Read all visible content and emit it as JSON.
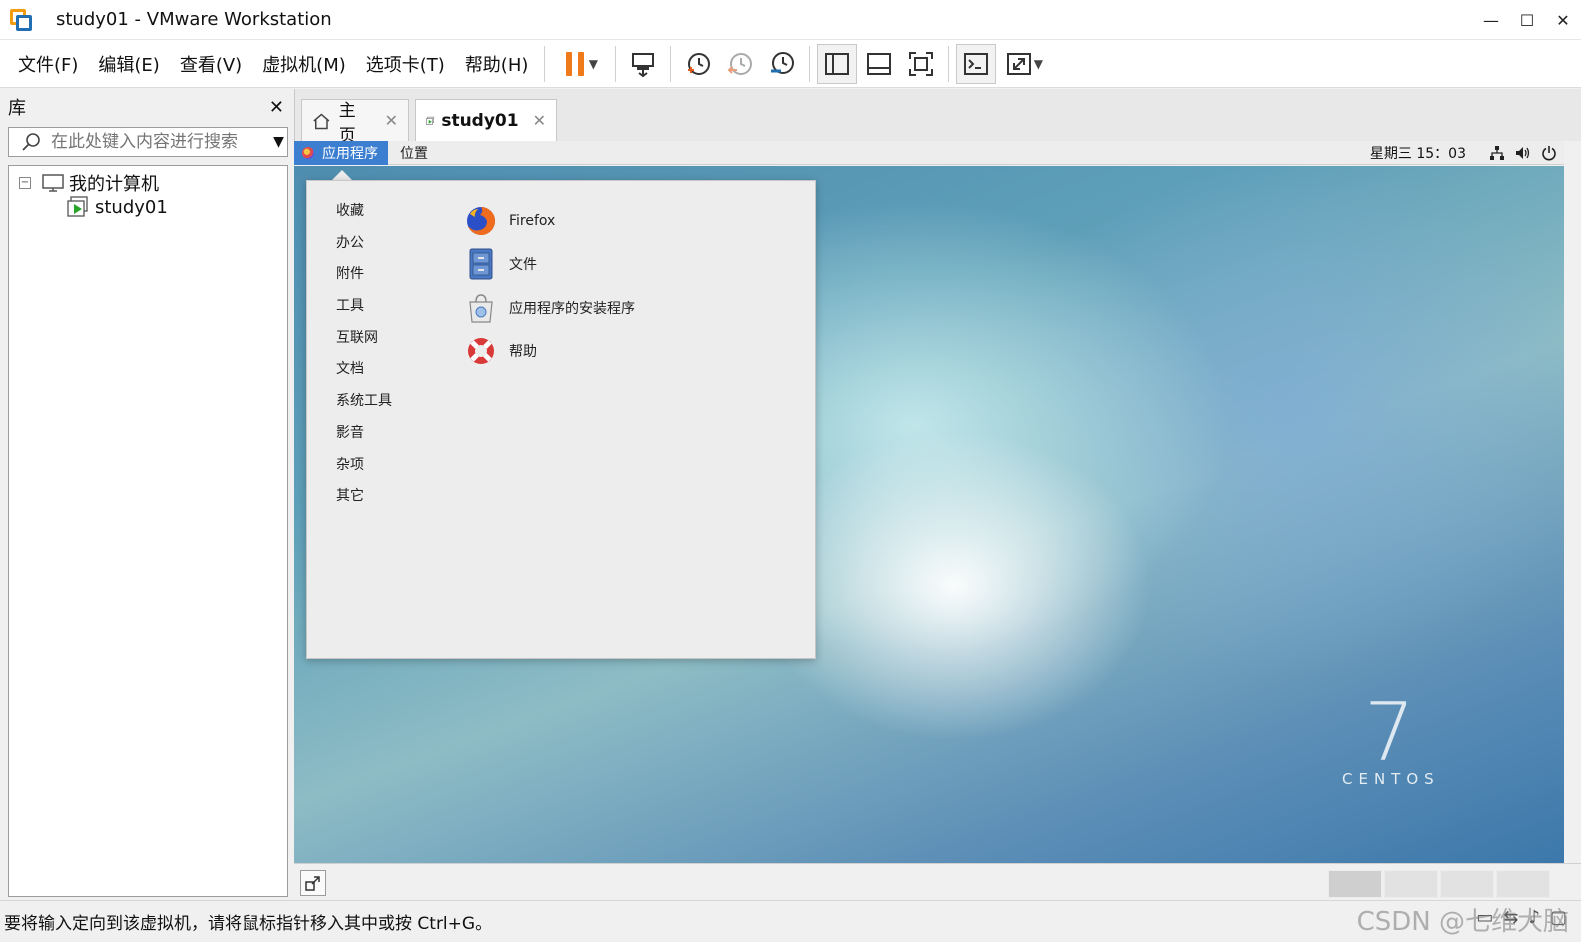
{
  "window": {
    "title": "study01 - VMware Workstation",
    "controls": {
      "minimize": "—",
      "maximize": "☐",
      "close": "✕"
    }
  },
  "menu": {
    "items": [
      "文件(F)",
      "编辑(E)",
      "查看(V)",
      "虚拟机(M)",
      "选项卡(T)",
      "帮助(H)"
    ]
  },
  "toolbar": {
    "buttons": [
      "pause-icon",
      "send-ctrl-alt-del-icon",
      "snapshot-take-icon",
      "snapshot-revert-icon",
      "snapshot-manager-icon",
      "library-view-icon",
      "thumbnail-view-icon",
      "full-screen-icon",
      "console-view-icon",
      "stretch-icon"
    ],
    "accent": "#f07a1a"
  },
  "library": {
    "title": "库",
    "close": "✕",
    "search_placeholder": "在此处键入内容进行搜索",
    "tree": {
      "root": "我的计算机",
      "toggle": "−",
      "children": [
        "study01"
      ]
    }
  },
  "tabs": [
    {
      "label": "主页",
      "icon": "home-icon",
      "close": "✕",
      "active": false
    },
    {
      "label": "study01",
      "icon": "vm-running-icon",
      "close": "✕",
      "active": true
    }
  ],
  "guest": {
    "top_bar": {
      "applications": "应用程序",
      "places": "位置",
      "clock": "星期三 15：03"
    },
    "app_menu": {
      "categories": [
        "收藏",
        "办公",
        "附件",
        "工具",
        "互联网",
        "文档",
        "系统工具",
        "影音",
        "杂项",
        "其它"
      ],
      "apps": [
        {
          "label": "Firefox",
          "icon": "firefox-icon"
        },
        {
          "label": "文件",
          "icon": "file-cabinet-icon"
        },
        {
          "label": "应用程序的安装程序",
          "icon": "software-installer-icon"
        },
        {
          "label": "帮助",
          "icon": "lifebuoy-help-icon"
        }
      ]
    },
    "branding": {
      "number": "7",
      "word": "CENTOS"
    }
  },
  "status": {
    "text": "要将输入定向到该虚拟机，请将鼠标指针移入其中或按 Ctrl+G。",
    "watermark": "CSDN @七维大脑"
  }
}
